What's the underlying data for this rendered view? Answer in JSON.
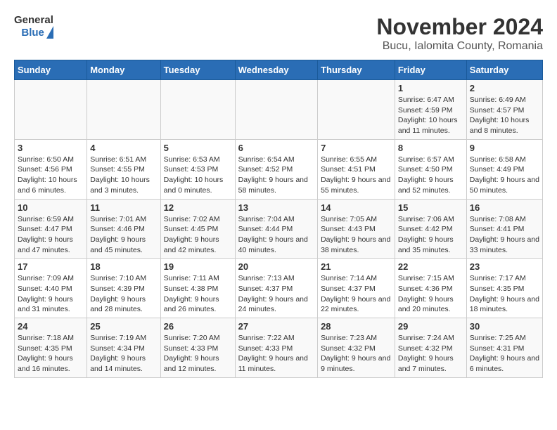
{
  "header": {
    "logo_general": "General",
    "logo_blue": "Blue",
    "title": "November 2024",
    "subtitle": "Bucu, Ialomita County, Romania"
  },
  "days_of_week": [
    "Sunday",
    "Monday",
    "Tuesday",
    "Wednesday",
    "Thursday",
    "Friday",
    "Saturday"
  ],
  "weeks": [
    [
      {
        "num": "",
        "info": ""
      },
      {
        "num": "",
        "info": ""
      },
      {
        "num": "",
        "info": ""
      },
      {
        "num": "",
        "info": ""
      },
      {
        "num": "",
        "info": ""
      },
      {
        "num": "1",
        "info": "Sunrise: 6:47 AM\nSunset: 4:59 PM\nDaylight: 10 hours and 11 minutes."
      },
      {
        "num": "2",
        "info": "Sunrise: 6:49 AM\nSunset: 4:57 PM\nDaylight: 10 hours and 8 minutes."
      }
    ],
    [
      {
        "num": "3",
        "info": "Sunrise: 6:50 AM\nSunset: 4:56 PM\nDaylight: 10 hours and 6 minutes."
      },
      {
        "num": "4",
        "info": "Sunrise: 6:51 AM\nSunset: 4:55 PM\nDaylight: 10 hours and 3 minutes."
      },
      {
        "num": "5",
        "info": "Sunrise: 6:53 AM\nSunset: 4:53 PM\nDaylight: 10 hours and 0 minutes."
      },
      {
        "num": "6",
        "info": "Sunrise: 6:54 AM\nSunset: 4:52 PM\nDaylight: 9 hours and 58 minutes."
      },
      {
        "num": "7",
        "info": "Sunrise: 6:55 AM\nSunset: 4:51 PM\nDaylight: 9 hours and 55 minutes."
      },
      {
        "num": "8",
        "info": "Sunrise: 6:57 AM\nSunset: 4:50 PM\nDaylight: 9 hours and 52 minutes."
      },
      {
        "num": "9",
        "info": "Sunrise: 6:58 AM\nSunset: 4:49 PM\nDaylight: 9 hours and 50 minutes."
      }
    ],
    [
      {
        "num": "10",
        "info": "Sunrise: 6:59 AM\nSunset: 4:47 PM\nDaylight: 9 hours and 47 minutes."
      },
      {
        "num": "11",
        "info": "Sunrise: 7:01 AM\nSunset: 4:46 PM\nDaylight: 9 hours and 45 minutes."
      },
      {
        "num": "12",
        "info": "Sunrise: 7:02 AM\nSunset: 4:45 PM\nDaylight: 9 hours and 42 minutes."
      },
      {
        "num": "13",
        "info": "Sunrise: 7:04 AM\nSunset: 4:44 PM\nDaylight: 9 hours and 40 minutes."
      },
      {
        "num": "14",
        "info": "Sunrise: 7:05 AM\nSunset: 4:43 PM\nDaylight: 9 hours and 38 minutes."
      },
      {
        "num": "15",
        "info": "Sunrise: 7:06 AM\nSunset: 4:42 PM\nDaylight: 9 hours and 35 minutes."
      },
      {
        "num": "16",
        "info": "Sunrise: 7:08 AM\nSunset: 4:41 PM\nDaylight: 9 hours and 33 minutes."
      }
    ],
    [
      {
        "num": "17",
        "info": "Sunrise: 7:09 AM\nSunset: 4:40 PM\nDaylight: 9 hours and 31 minutes."
      },
      {
        "num": "18",
        "info": "Sunrise: 7:10 AM\nSunset: 4:39 PM\nDaylight: 9 hours and 28 minutes."
      },
      {
        "num": "19",
        "info": "Sunrise: 7:11 AM\nSunset: 4:38 PM\nDaylight: 9 hours and 26 minutes."
      },
      {
        "num": "20",
        "info": "Sunrise: 7:13 AM\nSunset: 4:37 PM\nDaylight: 9 hours and 24 minutes."
      },
      {
        "num": "21",
        "info": "Sunrise: 7:14 AM\nSunset: 4:37 PM\nDaylight: 9 hours and 22 minutes."
      },
      {
        "num": "22",
        "info": "Sunrise: 7:15 AM\nSunset: 4:36 PM\nDaylight: 9 hours and 20 minutes."
      },
      {
        "num": "23",
        "info": "Sunrise: 7:17 AM\nSunset: 4:35 PM\nDaylight: 9 hours and 18 minutes."
      }
    ],
    [
      {
        "num": "24",
        "info": "Sunrise: 7:18 AM\nSunset: 4:35 PM\nDaylight: 9 hours and 16 minutes."
      },
      {
        "num": "25",
        "info": "Sunrise: 7:19 AM\nSunset: 4:34 PM\nDaylight: 9 hours and 14 minutes."
      },
      {
        "num": "26",
        "info": "Sunrise: 7:20 AM\nSunset: 4:33 PM\nDaylight: 9 hours and 12 minutes."
      },
      {
        "num": "27",
        "info": "Sunrise: 7:22 AM\nSunset: 4:33 PM\nDaylight: 9 hours and 11 minutes."
      },
      {
        "num": "28",
        "info": "Sunrise: 7:23 AM\nSunset: 4:32 PM\nDaylight: 9 hours and 9 minutes."
      },
      {
        "num": "29",
        "info": "Sunrise: 7:24 AM\nSunset: 4:32 PM\nDaylight: 9 hours and 7 minutes."
      },
      {
        "num": "30",
        "info": "Sunrise: 7:25 AM\nSunset: 4:31 PM\nDaylight: 9 hours and 6 minutes."
      }
    ]
  ]
}
